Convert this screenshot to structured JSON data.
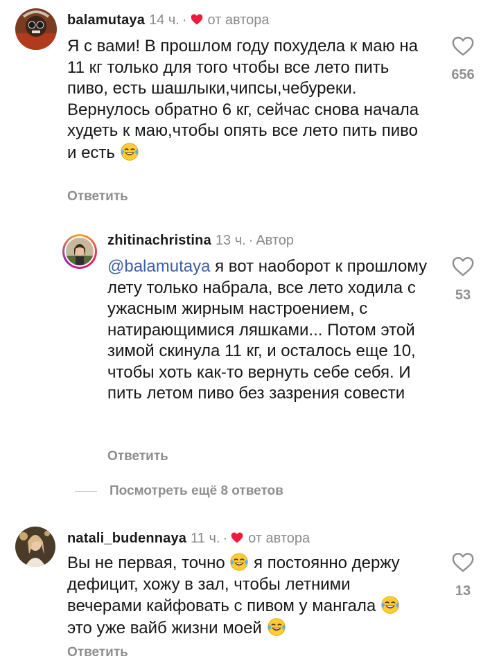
{
  "comments": [
    {
      "username": "balamutaya",
      "time": "14 ч.",
      "author_badge": "от автора",
      "text": "Я с вами! В прошлом году похудела к маю на 11 кг только для того чтобы все лето пить пиво, есть шашлыки,чипсы,чебуреки. Вернулось обратно 6 кг, сейчас  снова начала худеть к маю,чтобы опять все лето пить пиво и есть",
      "reply_label": "Ответить",
      "likes": "656"
    },
    {
      "username": "zhitinachristina",
      "time": "13 ч.",
      "author_badge": "Автор",
      "mention": "@balamutaya",
      "text": " я вот наоборот к прошлому лету только набрала, все лето ходила с ужасным жирным настроением, с натирающимися ляшками... Потом этой зимой скинула 11 кг, и осталось еще 10, чтобы хоть как-то вернуть себе себя. И пить летом пиво без зазрения совести",
      "reply_label": "Ответить",
      "likes": "53"
    },
    {
      "username": "natali_budennaya",
      "time": "11 ч.",
      "author_badge": "от автора",
      "text_part1": "Вы не первая, точно",
      "text_part2": " я постоянно держу дефицит, хожу в зал, чтобы летними вечерами кайфовать с пивом у мангала",
      "text_part3": " это уже вайб жизни моей",
      "reply_label": "Ответить",
      "likes": "13"
    }
  ],
  "view_more_replies": "Посмотреть ещё 8 ответов",
  "separator": "·",
  "colors": {
    "heart_red": "#ed1c3a",
    "mention": "#3b5fa8",
    "muted": "#8e8e8e"
  },
  "icons": [
    "heart-filled-icon",
    "heart-outline-icon",
    "laughing-tears-emoji"
  ]
}
